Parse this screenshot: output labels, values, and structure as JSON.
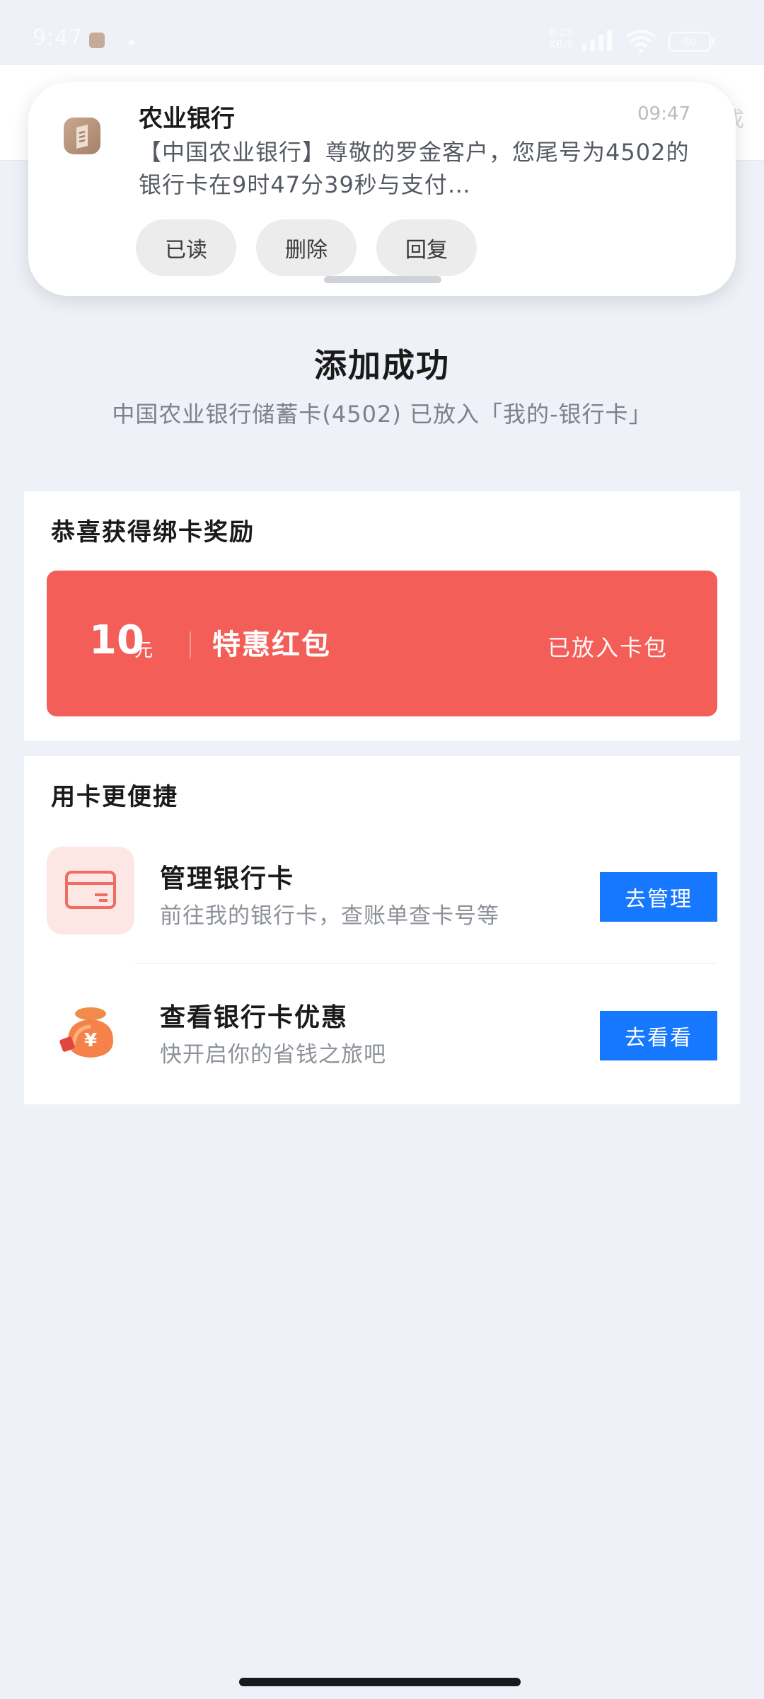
{
  "status_bar": {
    "time": "9:47",
    "net_speed_value": "6.25",
    "net_speed_unit": "KB/S",
    "battery": "80",
    "icons": [
      "app-notification-icon",
      "dot-icon",
      "signal-icon",
      "wifi-icon",
      "battery-icon"
    ]
  },
  "header": {
    "right_text": "成"
  },
  "notification": {
    "app_name": "农业银行",
    "time": "09:47",
    "body": "【中国农业银行】尊敬的罗金客户，您尾号为4502的银行卡在9时47分39秒与支付…",
    "actions": {
      "read": "已读",
      "delete": "删除",
      "reply": "回复"
    }
  },
  "success": {
    "title": "添加成功",
    "subtitle": "中国农业银行储蓄卡(4502) 已放入「我的-银行卡」"
  },
  "reward": {
    "title": "恭喜获得绑卡奖励",
    "amount": "10",
    "unit": "元",
    "name": "特惠红包",
    "status": "已放入卡包"
  },
  "convenience": {
    "title": "用卡更便捷",
    "items": [
      {
        "title": "管理银行卡",
        "desc": "前往我的银行卡，查账单查卡号等",
        "button": "去管理",
        "icon": "bank-card-icon"
      },
      {
        "title": "查看银行卡优惠",
        "desc": "快开启你的省钱之旅吧",
        "button": "去看看",
        "icon": "money-bag-icon"
      }
    ]
  },
  "colors": {
    "primary_blue": "#1677ff",
    "red_packet": "#f45e58",
    "page_background": "#eef1f7"
  }
}
